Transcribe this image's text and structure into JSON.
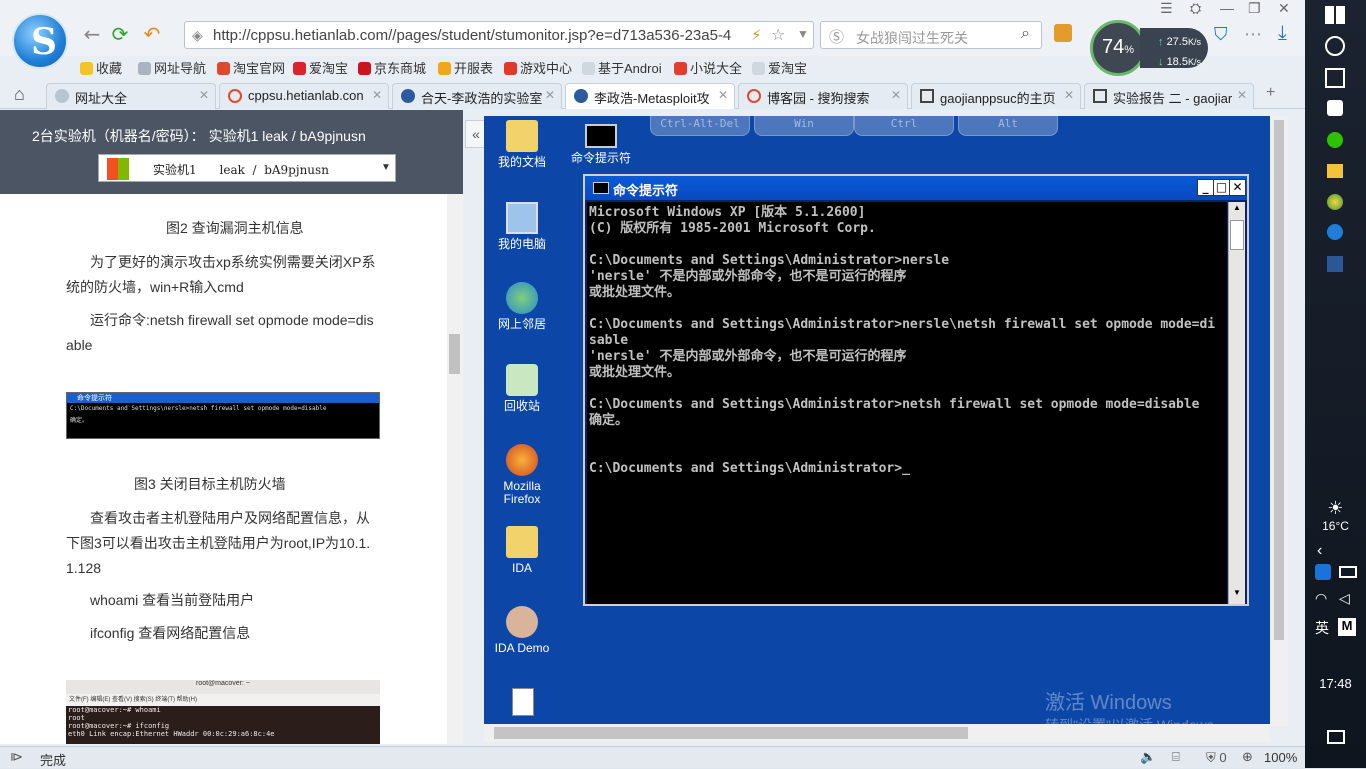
{
  "browser": {
    "logo_letter": "S",
    "address_url": "http://cppsu.hetianlab.com//pages/student/stumonitor.jsp?e=d713a536-23a5-4",
    "search_placeholder": "女战狼闯过生死关",
    "speed_percent": "74",
    "speed_pct_sign": "%",
    "upload_speed": "27.5",
    "download_speed": "18.5",
    "speed_unit": "K/s",
    "bookmarks": [
      "收藏",
      "网址导航",
      "淘宝官网",
      "爱淘宝",
      "京东商城",
      "开服表",
      "游戏中心",
      "基于Androi",
      "小说大全",
      "爱淘宝"
    ],
    "tabs": [
      {
        "label": "网址大全"
      },
      {
        "label": "cppsu.hetianlab.con"
      },
      {
        "label": "合天-李政浩的实验室"
      },
      {
        "label": "李政浩-Metasploit攻"
      },
      {
        "label": "博客园 - 搜狗搜索"
      },
      {
        "label": "gaojianppsuc的主页"
      },
      {
        "label": "实验报告 二 - gaojiar"
      }
    ],
    "status_text": "完成",
    "zoom": "100%",
    "blocked_count": "0"
  },
  "left_panel": {
    "header": "2台实验机（机器名/密码）：  实验机1    leak / bA9pjnusn",
    "select_value": "实验机1      leak  /  bA9pjnusn",
    "caption2": "图2 查询漏洞主机信息",
    "para1": "为了更好的演示攻击xp系统实例需要关闭XP系统的防火墙，win+R输入cmd",
    "para2": "运行命令:netsh firewall set opmode mode=disable",
    "thumb1_title": "命令提示符",
    "thumb1_line1": "C:\\Documents and Settings\\nersle>netsh firewall set opmode mode=disable",
    "thumb1_line2": "确定。",
    "caption3": "图3 关闭目标主机防火墙",
    "para3": "查看攻击者主机登陆用户及网络配置信息，从下图3可以看出攻击主机登陆用户为root,IP为10.1.1.128",
    "para4": "whoami  查看当前登陆用户",
    "para5": "ifconfig 查看网络配置信息",
    "thumb2_title": "root@macover: ~",
    "thumb2_menu": "文件(F)  编辑(E)  查看(V)  搜索(S)  终端(T)  帮助(H)",
    "thumb2_lines": [
      "root@macover:~# whoami",
      "root",
      "root@macover:~# ifconfig",
      "eth0      Link encap:Ethernet  HWaddr 00:0c:29:a6:8c:4e"
    ]
  },
  "remote": {
    "keys": [
      "Ctrl-Alt-Del",
      "Win",
      "Ctrl",
      "Alt"
    ],
    "desktop_icons": [
      {
        "label": "我的文档"
      },
      {
        "label": "命令提示符"
      },
      {
        "label": "我的电脑"
      },
      {
        "label": "网上邻居"
      },
      {
        "label": "回收站"
      },
      {
        "label": "Mozilla Firefox"
      },
      {
        "label": "IDA"
      },
      {
        "label": "IDA Demo"
      }
    ],
    "cmd_title": "命令提示符",
    "cmd_text": "Microsoft Windows XP [版本 5.1.2600]\n(C) 版权所有 1985-2001 Microsoft Corp.\n\nC:\\Documents and Settings\\Administrator>nersle\n'nersle' 不是内部或外部命令，也不是可运行的程序\n或批处理文件。\n\nC:\\Documents and Settings\\Administrator>nersle\\netsh firewall set opmode mode=di\nsable\n'nersle' 不是内部或外部命令，也不是可运行的程序\n或批处理文件。\n\nC:\\Documents and Settings\\Administrator>netsh firewall set opmode mode=disable\n确定。\n\n\nC:\\Documents and Settings\\Administrator>_",
    "activate_line1": "激活 Windows",
    "activate_line2": "转到\"设置\"以激活 Windows。"
  },
  "taskbar": {
    "temperature": "16°C",
    "language": "英",
    "ime": "M",
    "time": "17:48"
  },
  "colors": {
    "xp_desktop": "#0c47a8",
    "xp_title": "#0a49c0",
    "panel_header": "#4b5563"
  }
}
